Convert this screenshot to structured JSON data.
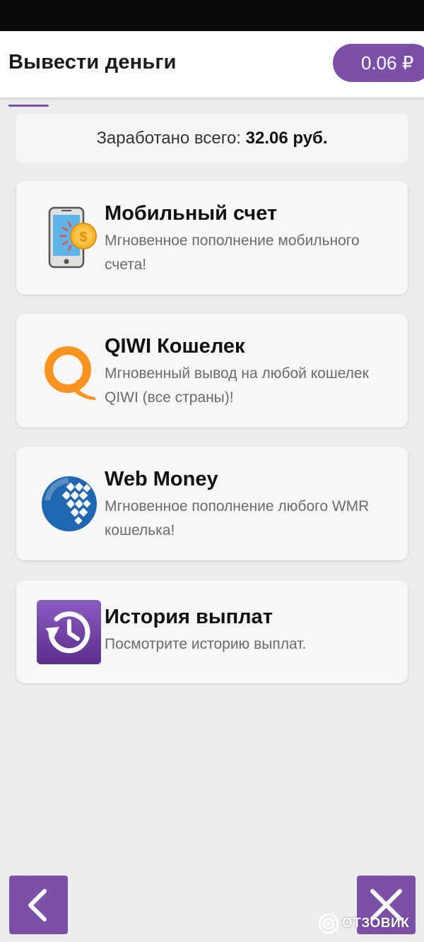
{
  "header": {
    "title": "Вывести деньги",
    "balance": "0.06 ₽"
  },
  "earned": {
    "label": "Заработано всего:",
    "value": "32.06 руб."
  },
  "options": [
    {
      "title": "Мобильный счет",
      "desc": "Мгновенное пополнение мобильного счета!",
      "icon": "mobile-phone-coin-icon"
    },
    {
      "title": "QIWI Кошелек",
      "desc": "Мгновенный вывод на любой кошелек QIWI (все страны)!",
      "icon": "qiwi-logo-icon"
    },
    {
      "title": "Web Money",
      "desc": "Мгновенное пополнение любого WMR кошелька!",
      "icon": "webmoney-logo-icon"
    },
    {
      "title": "История выплат",
      "desc": "Посмотрите историю выплат.",
      "icon": "history-icon"
    }
  ],
  "nav": {
    "back_icon": "chevron-left-icon",
    "close_icon": "close-icon"
  },
  "watermark": {
    "text": "ОТЗОВИК"
  },
  "colors": {
    "accent": "#7b50a8",
    "qiwi_orange": "#f7931e",
    "webmoney_blue": "#1f67b1"
  }
}
